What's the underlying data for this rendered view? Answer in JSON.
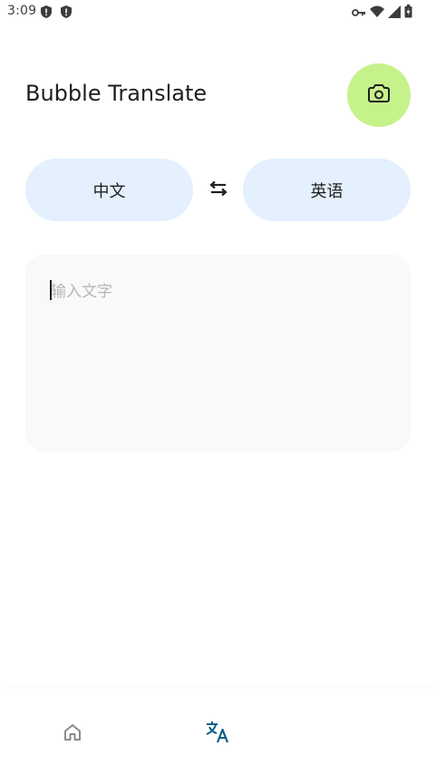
{
  "status_bar": {
    "time": "3:09",
    "left_icons": [
      "shield-icon",
      "shield-icon"
    ],
    "right_icons": [
      "vpn-key-icon",
      "wifi-icon",
      "signal-icon",
      "battery-icon"
    ]
  },
  "header": {
    "title": "Bubble Translate",
    "camera_icon": "camera-icon"
  },
  "languages": {
    "source": "中文",
    "target": "英语",
    "swap_icon": "swap-icon"
  },
  "input": {
    "value": "",
    "placeholder": "输入文字"
  },
  "bottom_nav": {
    "items": [
      {
        "icon": "home-icon",
        "active": false
      },
      {
        "icon": "translate-icon",
        "active": true
      }
    ]
  },
  "colors": {
    "camera_fab": "#c6f28c",
    "language_pill": "#e4f0fd",
    "input_card": "#f8f9fb",
    "active_nav": "#0b5f88",
    "inactive_nav": "#8a8a8a"
  }
}
